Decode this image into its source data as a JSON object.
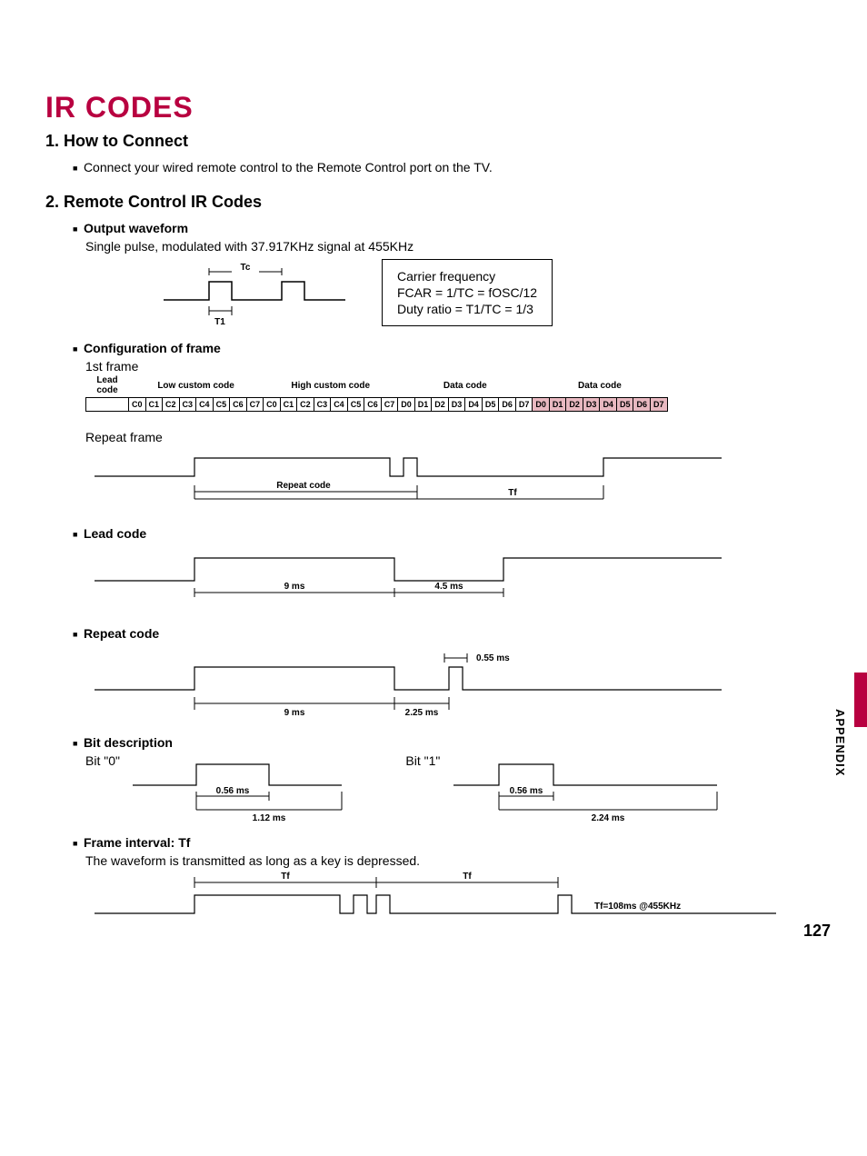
{
  "title": "IR CODES",
  "s1": {
    "heading": "1. How to Connect",
    "text": "Connect your wired remote control to the Remote Control port on the TV."
  },
  "s2": {
    "heading": "2. Remote Control IR Codes",
    "output": {
      "h": "Output waveform",
      "text": "Single pulse, modulated with 37.917KHz signal at 455KHz",
      "tc": "Tc",
      "t1": "T1",
      "carrier_title": "Carrier frequency",
      "fcar": "FCAR = 1/TC = fOSC/12",
      "duty": "Duty ratio = T1/TC = 1/3"
    },
    "config": {
      "h": "Configuration of frame",
      "first": "1st frame",
      "headers": [
        "Lead code",
        "Low custom code",
        "High custom code",
        "Data code",
        "Data code"
      ],
      "bits_low": [
        "C0",
        "C1",
        "C2",
        "C3",
        "C4",
        "C5",
        "C6",
        "C7"
      ],
      "bits_high": [
        "C0",
        "C1",
        "C2",
        "C3",
        "C4",
        "C5",
        "C6",
        "C7"
      ],
      "bits_d1": [
        "D0",
        "D1",
        "D2",
        "D3",
        "D4",
        "D5",
        "D6",
        "D7"
      ],
      "bits_d2": [
        "D0",
        "D1",
        "D2",
        "D3",
        "D4",
        "D5",
        "D6",
        "D7"
      ],
      "repeat": "Repeat frame",
      "repeat_label": "Repeat code",
      "tf": "Tf"
    },
    "lead": {
      "h": "Lead code",
      "t9": "9 ms",
      "t45": "4.5 ms"
    },
    "repeat_code": {
      "h": "Repeat code",
      "t055": "0.55 ms",
      "t9": "9 ms",
      "t225": "2.25 ms"
    },
    "bit": {
      "h": "Bit description",
      "b0": "Bit \"0\"",
      "b1": "Bit \"1\"",
      "t056": "0.56 ms",
      "t112": "1.12 ms",
      "t224": "2.24 ms"
    },
    "interval": {
      "h": "Frame interval: Tf",
      "text": "The waveform is transmitted as long as a key is depressed.",
      "tf": "Tf",
      "note": "Tf=108ms @455KHz"
    }
  },
  "side": "APPENDIX",
  "page": "127"
}
